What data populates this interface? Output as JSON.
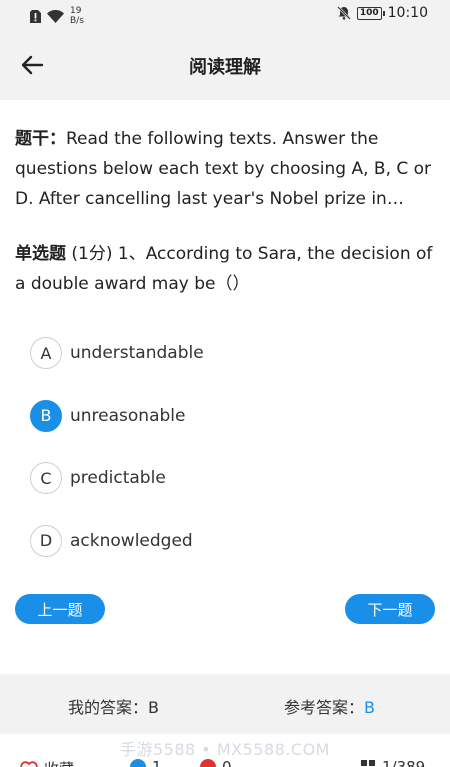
{
  "statusbar": {
    "net_speed_value": "19",
    "net_speed_unit": "B/s",
    "battery": "100",
    "time": "10:10"
  },
  "header": {
    "title": "阅读理解"
  },
  "stem": {
    "label": "题干：",
    "text": "Read the following texts. Answer the questions below each text by choosing A, B, C or D. After cancelling last year's Nobel prize in literature"
  },
  "question": {
    "type": "单选题",
    "score": " (1分) ",
    "number": "1、",
    "text": "According to Sara, the decision of a double award may be（）"
  },
  "options": [
    {
      "letter": "A",
      "text": "understandable",
      "selected": false
    },
    {
      "letter": "B",
      "text": "unreasonable",
      "selected": true
    },
    {
      "letter": "C",
      "text": "predictable",
      "selected": false
    },
    {
      "letter": "D",
      "text": "acknowledged",
      "selected": false
    }
  ],
  "nav": {
    "prev_label": "上一题",
    "next_label": "下一题"
  },
  "answers": {
    "my_label": "我的答案：",
    "my_value": "B",
    "ref_label": "参考答案：",
    "ref_value": "B"
  },
  "bottom": {
    "favorite_label": "收藏",
    "correct_count": "1",
    "wrong_count": "0",
    "progress": "1/389"
  },
  "watermark": "手游5588 • MX5588.COM",
  "colors": {
    "accent": "#1a8fe8",
    "bar_bg": "#f2f2f2",
    "wrong": "#e0322e",
    "favorite": "#e0322e"
  }
}
